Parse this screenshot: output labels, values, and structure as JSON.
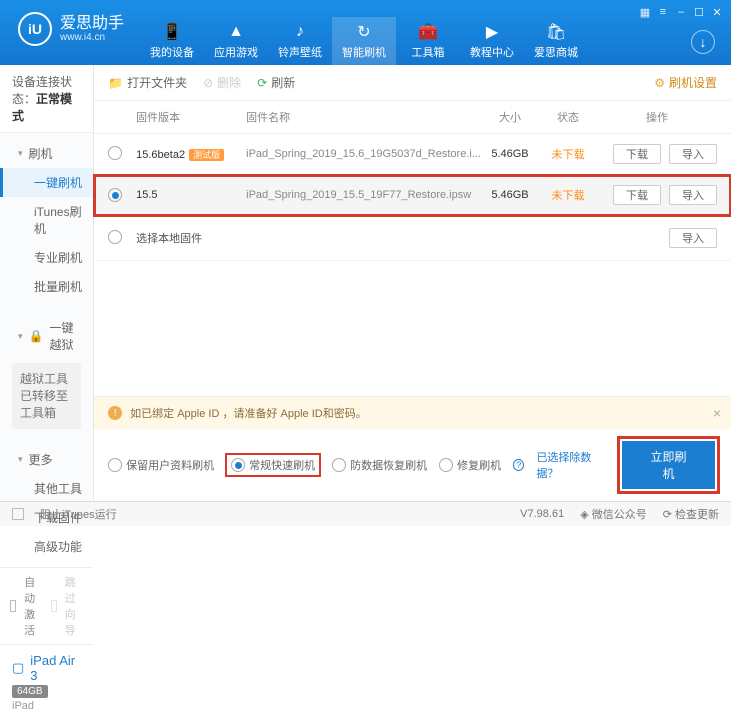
{
  "brand": {
    "name": "爱思助手",
    "url": "www.i4.cn",
    "logo": "iU"
  },
  "titlebar": [
    "▦",
    "≡",
    "–",
    "☐",
    "✕"
  ],
  "nav": [
    {
      "label": "我的设备",
      "icon": "📱"
    },
    {
      "label": "应用游戏",
      "icon": "▲"
    },
    {
      "label": "铃声壁纸",
      "icon": "♪"
    },
    {
      "label": "智能刷机",
      "icon": "↻",
      "active": true
    },
    {
      "label": "工具箱",
      "icon": "🧰"
    },
    {
      "label": "教程中心",
      "icon": "▶"
    },
    {
      "label": "爱思商城",
      "icon": "🛍"
    }
  ],
  "sidebar": {
    "status_label": "设备连接状态：",
    "status_value": "正常模式",
    "groups": [
      {
        "head": "刷机",
        "items": [
          {
            "label": "一键刷机",
            "active": true
          },
          {
            "label": "iTunes刷机"
          },
          {
            "label": "专业刷机"
          },
          {
            "label": "批量刷机"
          }
        ]
      },
      {
        "head": "一键越狱",
        "locked": true,
        "items": [
          {
            "label": "越狱工具已转移至工具箱",
            "box": true
          }
        ]
      },
      {
        "head": "更多",
        "items": [
          {
            "label": "其他工具"
          },
          {
            "label": "下载固件"
          },
          {
            "label": "高级功能"
          }
        ]
      }
    ],
    "auto_activate": "自动激活",
    "skip_guide": "跳过向导",
    "device": {
      "name": "iPad Air 3",
      "storage": "64GB",
      "type": "iPad"
    }
  },
  "toolbar": {
    "open": "打开文件夹",
    "delete": "删除",
    "refresh": "刷新",
    "settings": "刷机设置"
  },
  "table": {
    "headers": {
      "version": "固件版本",
      "name": "固件名称",
      "size": "大小",
      "status": "状态",
      "ops": "操作"
    },
    "rows": [
      {
        "version": "15.6beta2",
        "beta": "测试版",
        "name": "iPad_Spring_2019_15.6_19G5037d_Restore.i...",
        "size": "5.46GB",
        "status": "未下载",
        "download": "下载",
        "import": "导入",
        "selected": false
      },
      {
        "version": "15.5",
        "name": "iPad_Spring_2019_15.5_19F77_Restore.ipsw",
        "size": "5.46GB",
        "status": "未下载",
        "download": "下载",
        "import": "导入",
        "selected": true,
        "highlight": true
      }
    ],
    "local_row": {
      "label": "选择本地固件",
      "import": "导入"
    }
  },
  "warning": "如已绑定 Apple ID ，请准备好 Apple ID和密码。",
  "options": {
    "keep_data": "保留用户资料刷机",
    "normal": "常规快速刷机",
    "anti_recovery": "防数据恢复刷机",
    "repair": "修复刷机",
    "exclude_link": "已选择除数据？",
    "flash_btn": "立即刷机"
  },
  "footer": {
    "block_itunes": "阻止iTunes运行",
    "version": "V7.98.61",
    "wechat": "微信公众号",
    "check_update": "检查更新"
  }
}
